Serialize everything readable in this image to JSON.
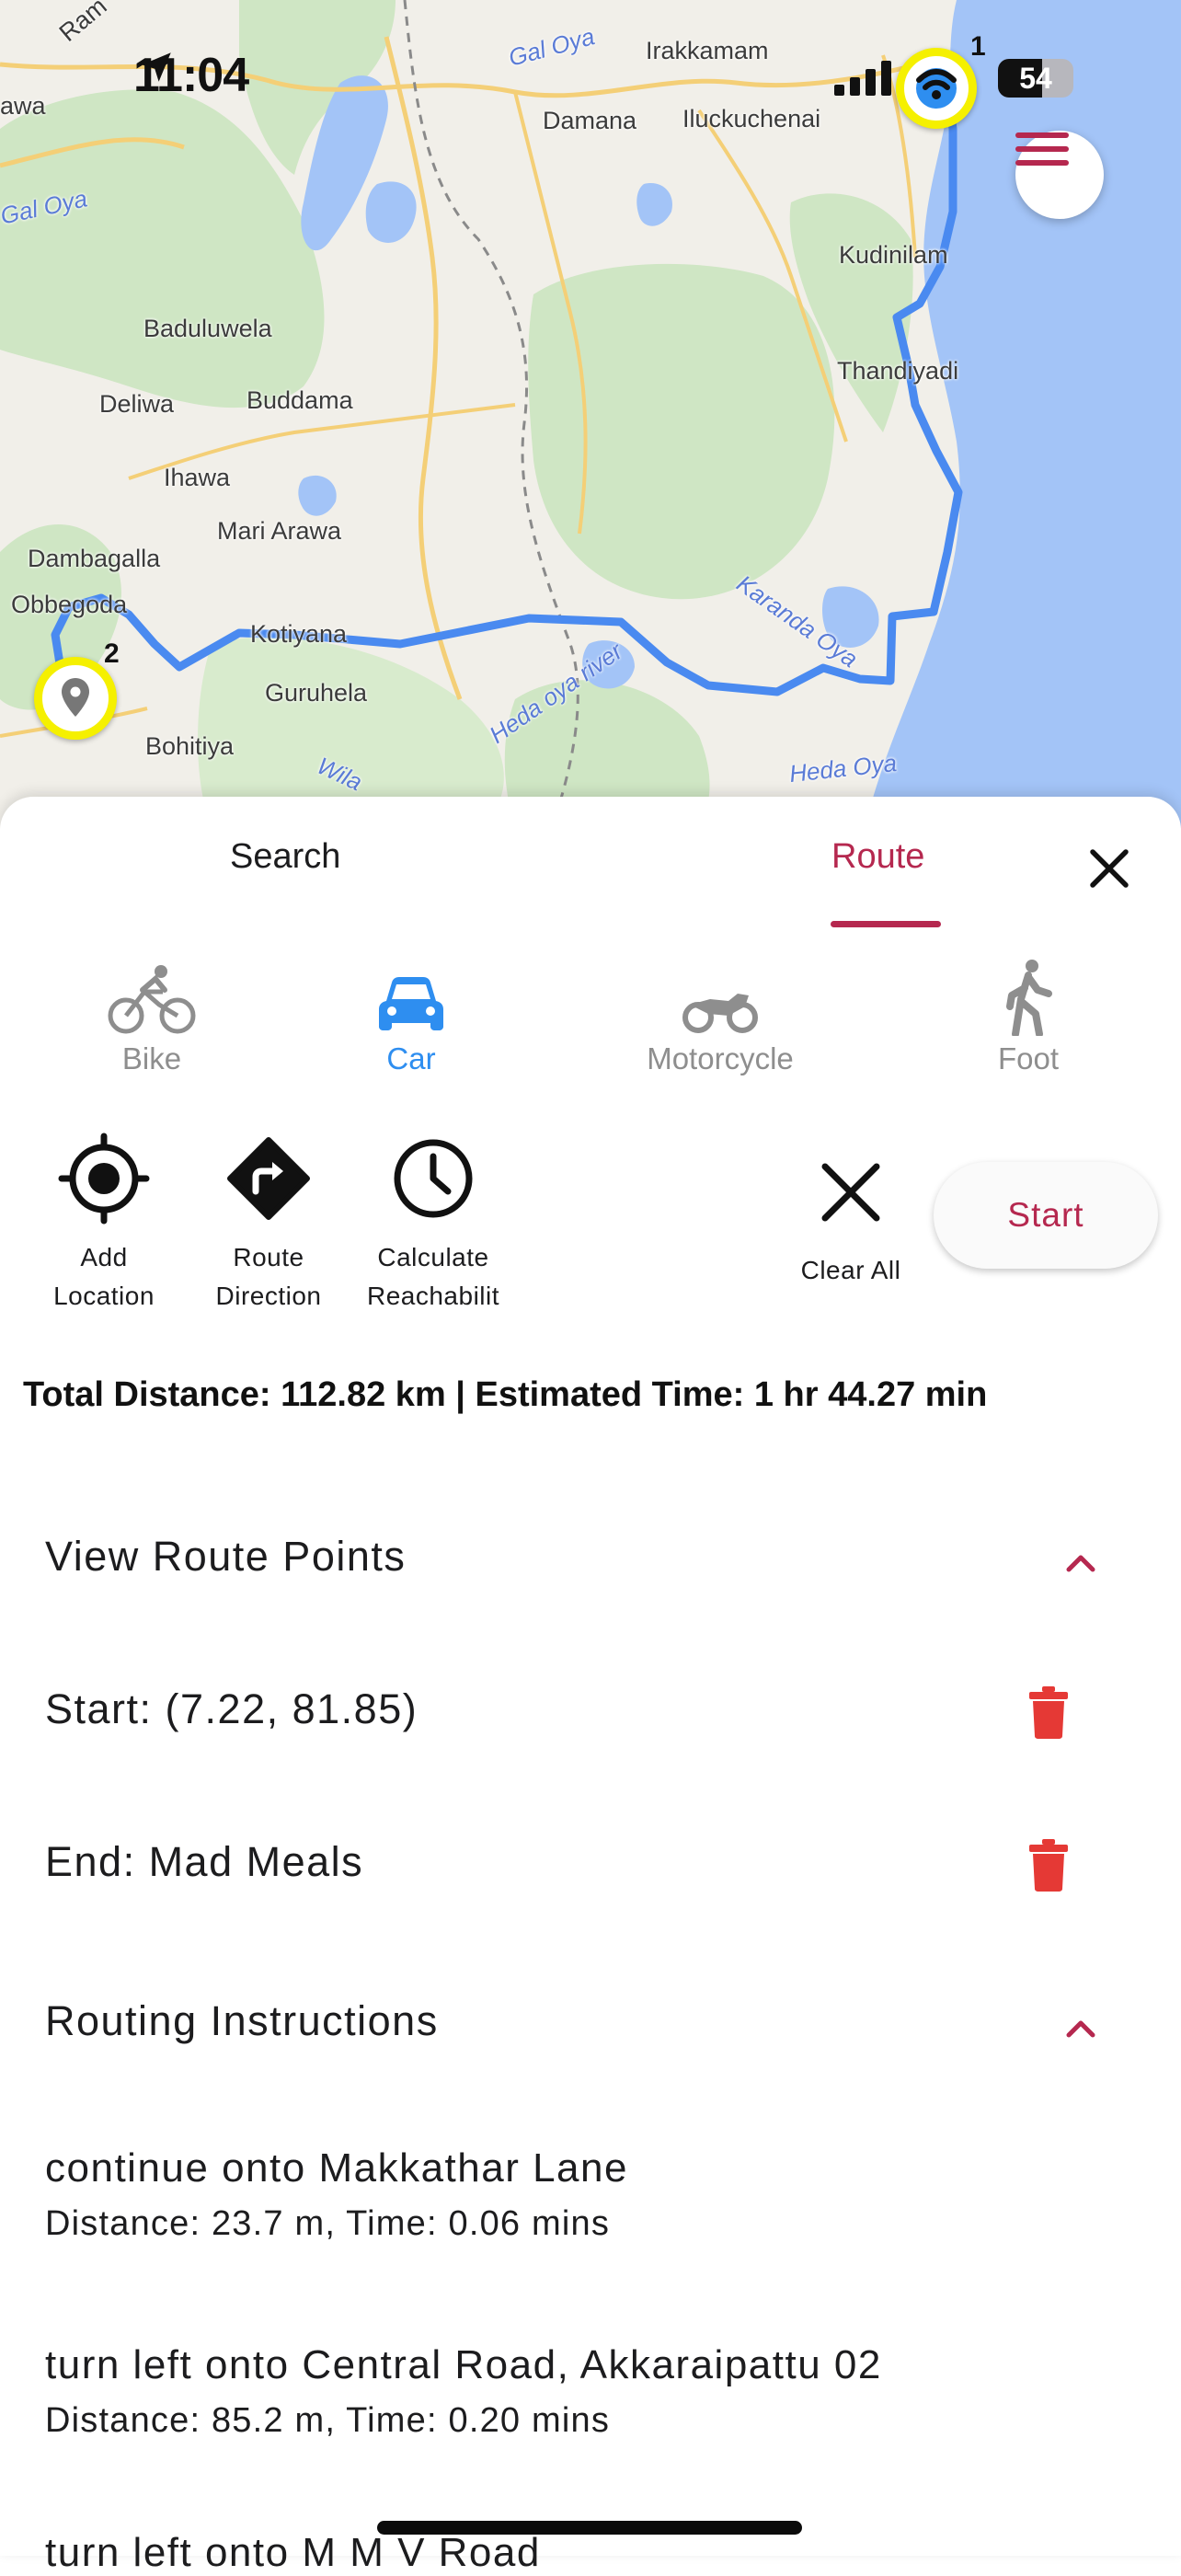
{
  "status_bar": {
    "time": "11:04",
    "battery": "54"
  },
  "map": {
    "labels": [
      {
        "text": "Ram",
        "type": "place"
      },
      {
        "text": "Gal Oya",
        "type": "water"
      },
      {
        "text": "Irakkamam",
        "type": "place"
      },
      {
        "text": "awa",
        "type": "place"
      },
      {
        "text": "Damana",
        "type": "place"
      },
      {
        "text": "Iluckuchenai",
        "type": "place"
      },
      {
        "text": "Gal Oya",
        "type": "water"
      },
      {
        "text": "Kudinilam",
        "type": "place"
      },
      {
        "text": "Baduluwela",
        "type": "place"
      },
      {
        "text": "Thandiyadi",
        "type": "place"
      },
      {
        "text": "Deliwa",
        "type": "place"
      },
      {
        "text": "Buddama",
        "type": "place"
      },
      {
        "text": "Ihawa",
        "type": "place"
      },
      {
        "text": "Mari Arawa",
        "type": "place"
      },
      {
        "text": "Dambagalla",
        "type": "place"
      },
      {
        "text": "Obbegoda",
        "type": "place"
      },
      {
        "text": "Kotiyana",
        "type": "place"
      },
      {
        "text": "Karanda Oya",
        "type": "water"
      },
      {
        "text": "Guruhela",
        "type": "place"
      },
      {
        "text": "Heda oya river",
        "type": "water"
      },
      {
        "text": "Bohitiya",
        "type": "place"
      },
      {
        "text": "Wila",
        "type": "water"
      },
      {
        "text": "Heda Oya",
        "type": "water"
      }
    ],
    "markers": [
      {
        "number": "1",
        "icon": "gps-location-icon"
      },
      {
        "number": "2",
        "icon": "map-pin-icon"
      }
    ],
    "route_color": "#4a8af0"
  },
  "sheet": {
    "tabs": {
      "search": "Search",
      "route": "Route"
    },
    "modes": [
      {
        "label": "Bike",
        "icon": "bicycle-icon"
      },
      {
        "label": "Car",
        "icon": "car-icon",
        "active": true
      },
      {
        "label": "Motorcycle",
        "icon": "motorcycle-icon"
      },
      {
        "label": "Foot",
        "icon": "walking-icon"
      }
    ],
    "actions": {
      "add_location": "Add\nLocation",
      "route_direction": "Route\nDirection",
      "reachability": "Calculate\nReachabilit",
      "clear_all": "Clear All",
      "start": "Start"
    },
    "summary": "Total Distance: 112.82 km | Estimated Time: 1 hr 44.27 min",
    "view_route_points": "View Route Points",
    "route_points": [
      {
        "label": "Start: (7.22, 81.85)"
      },
      {
        "label": "End: Mad Meals"
      }
    ],
    "routing_instructions_title": "Routing Instructions",
    "instructions": [
      {
        "text": "continue onto Makkathar Lane",
        "detail": "Distance: 23.7 m, Time: 0.06 mins"
      },
      {
        "text": "turn left onto Central Road, Akkaraipattu 02",
        "detail": "Distance: 85.2 m, Time: 0.20 mins"
      },
      {
        "text": "turn left onto M M V Road",
        "detail": ""
      }
    ]
  },
  "colors": {
    "accent": "#b5284f",
    "active_mode": "#2e8ef0",
    "delete": "#e53935",
    "marker_ring": "#f5f000"
  }
}
